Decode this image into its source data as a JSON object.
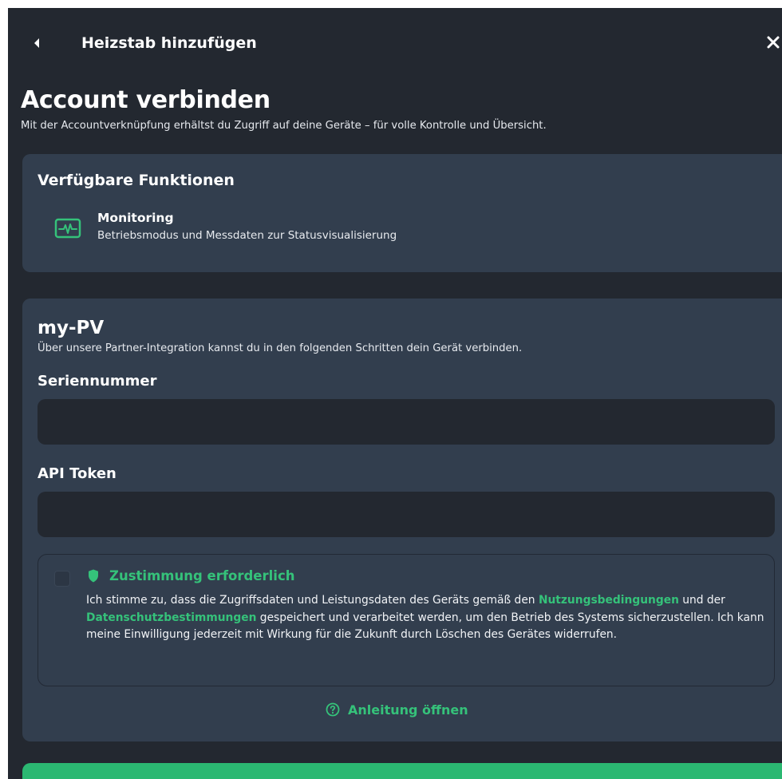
{
  "header": {
    "title": "Heizstab hinzufügen"
  },
  "page": {
    "title": "Account verbinden",
    "subtitle": "Mit der Accountverknüpfung erhältst du Zugriff auf deine Geräte – für volle Kontrolle und Übersicht."
  },
  "functions": {
    "title": "Verfügbare Funktionen",
    "items": [
      {
        "name": "Monitoring",
        "description": "Betriebsmodus und Messdaten zur Statusvisualisierung",
        "icon": "monitoring-icon"
      }
    ]
  },
  "provider": {
    "name": "my-PV",
    "description": "Über unsere Partner-Integration kannst du in den folgenden Schritten dein Gerät verbinden.",
    "serial_label": "Seriennummer",
    "serial_value": "",
    "token_label": "API Token",
    "token_value": ""
  },
  "consent": {
    "checked": false,
    "title": "Zustimmung erforderlich",
    "text_part1": "Ich stimme zu, dass die Zugriffsdaten und Leistungsdaten des Geräts gemäß den ",
    "terms_link": "Nutzungsbedingungen",
    "text_part2": " und der ",
    "privacy_link": "Datenschutzbestimmungen",
    "text_part3": " gespeichert und verarbeitet werden, um den Betrieb des Systems sicherzustellen. Ich kann meine Einwilligung jederzeit mit Wirkung für die Zukunft durch Löschen des Gerätes widerrufen."
  },
  "guide": {
    "label": "Anleitung öffnen"
  },
  "colors": {
    "background": "#232830",
    "card": "#323e4e",
    "accent": "#35c27a",
    "button": "#2bb872"
  }
}
